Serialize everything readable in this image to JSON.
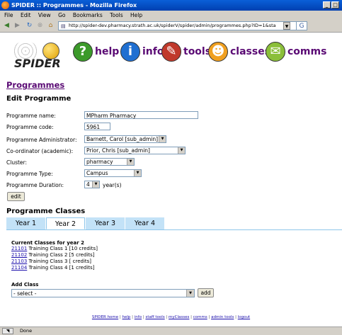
{
  "window": {
    "title": "SPIDER :: Programmes - Mozilla Firefox",
    "controls": [
      "_",
      "□"
    ]
  },
  "menu": [
    "File",
    "Edit",
    "View",
    "Go",
    "Bookmarks",
    "Tools",
    "Help"
  ],
  "browser": {
    "url": "http://spider-dev.pharmacy.strath.ac.uk/spiderV/spider/admin/programmes.php?ID=1&sta"
  },
  "banner": {
    "logo_text": "SPIDER",
    "nav": [
      {
        "label": "help",
        "glyph": "?",
        "color": "#3c9a2a"
      },
      {
        "label": "info",
        "glyph": "i",
        "color": "#1f6fd1"
      },
      {
        "label": "tools",
        "glyph": "✎",
        "color": "#c0392b"
      },
      {
        "label": "classes",
        "glyph": "☻",
        "color": "#f0a020"
      },
      {
        "label": "comms",
        "glyph": "✉",
        "color": "#8bbf3a"
      }
    ]
  },
  "page": {
    "heading": "Programmes",
    "subheading": "Edit Programme"
  },
  "form": {
    "name_label": "Programme name:",
    "name_value": "MPharm Pharmacy",
    "code_label": "Programme code:",
    "code_value": "5961",
    "admin_label": "Programme Administrator:",
    "admin_value": "Barnett, Carol [sub_admin]",
    "coord_label": "Co-ordinator (academic):",
    "coord_value": "Prior, Chris [sub_admin]",
    "cluster_label": "Cluster:",
    "cluster_value": "pharmacy",
    "type_label": "Programme Type:",
    "type_value": "Campus",
    "duration_label": "Programme Duration:",
    "duration_value": "4",
    "duration_suffix": "year(s)",
    "edit_button": "edit"
  },
  "classes": {
    "heading": "Programme Classes",
    "tabs": [
      "Year 1",
      "Year 2",
      "Year 3",
      "Year 4"
    ],
    "active_tab": "Year 2",
    "current_heading": "Current Classes for year 2",
    "rows": [
      {
        "code": "21101",
        "desc": "Training Class 1 [10 credits]"
      },
      {
        "code": "21102",
        "desc": "Training Class 2 [5 credits]"
      },
      {
        "code": "21103",
        "desc": "Training Class 3 [ credits]"
      },
      {
        "code": "21104",
        "desc": "Training Class 4 [1 credits]"
      }
    ],
    "add_label": "Add Class",
    "add_select": "- select -",
    "add_button": "add"
  },
  "footer": {
    "links": [
      "SPIDER home",
      "help",
      "info",
      "staff tools",
      "myClasses",
      "comms",
      "admin tools",
      "logout"
    ]
  },
  "status": {
    "text": "Done"
  }
}
